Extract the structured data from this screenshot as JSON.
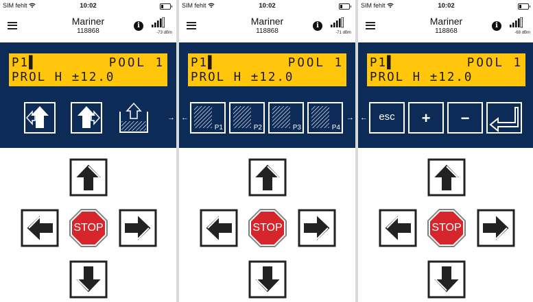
{
  "phones": [
    {
      "status": {
        "carrier": "SIM fehlt",
        "time": "10:02"
      },
      "header": {
        "title": "Mariner",
        "subtitle": "118868",
        "signal": "-73 dBm"
      },
      "lcd": {
        "line1_left": "P1▌",
        "line1_right": "POOL 1",
        "line2": "PROL H ±12.0"
      },
      "functions": [
        "pump-out-left-icon",
        "pump-out-right-icon",
        "tank-fill-icon"
      ],
      "nav_right": "→"
    },
    {
      "status": {
        "carrier": "SIM fehlt",
        "time": "10:02"
      },
      "header": {
        "title": "Mariner",
        "subtitle": "118868",
        "signal": "-71 dBm"
      },
      "lcd": {
        "line1_left": "P1▌",
        "line1_right": "POOL 1",
        "line2": "PROL H ±12.0"
      },
      "functions": [
        "P1",
        "P2",
        "P3",
        "P4"
      ],
      "nav_left": "←",
      "nav_right": "→"
    },
    {
      "status": {
        "carrier": "SIM fehlt",
        "time": "10:02"
      },
      "header": {
        "title": "Mariner",
        "subtitle": "118868",
        "signal": "-68 dBm"
      },
      "lcd": {
        "line1_left": "P1▌",
        "line1_right": "POOL 1",
        "line2": "PROL H ±12.0"
      },
      "functions": [
        "esc",
        "+",
        "−",
        "enter-icon"
      ],
      "nav_left": "←"
    }
  ],
  "dpad": {
    "stop_label": "STOP"
  },
  "colors": {
    "panel": "#0d2b57",
    "lcd": "#ffc60b",
    "stop": "#d7262b"
  }
}
